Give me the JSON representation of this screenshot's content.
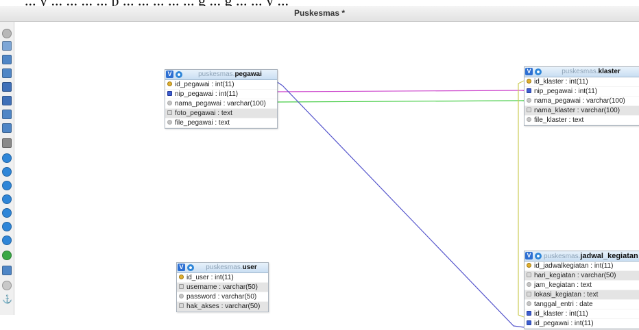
{
  "app": {
    "window_title": "Puskesmas *"
  },
  "top_text": "... y ... ... ... ... p ... ... ... ... ... g ... g ... ... y ...",
  "toolbar": [
    {
      "icon": "angular-links-icon",
      "color": "#b8b8b8",
      "shape": "round"
    },
    {
      "icon": "toggle-all-icon",
      "color": "#7da6d6",
      "shape": "sq"
    },
    {
      "icon": "add-tables-icon",
      "color": "#4f86c6",
      "shape": "sq"
    },
    {
      "icon": "edit-icon",
      "color": "#4f86c6",
      "shape": "sq"
    },
    {
      "icon": "save-icon",
      "color": "#3f70b8",
      "shape": "sq"
    },
    {
      "icon": "save-as-icon",
      "color": "#3f70b8",
      "shape": "sq"
    },
    {
      "icon": "delete-page-icon",
      "color": "#4f86c6",
      "shape": "sq"
    },
    {
      "icon": "view-icon",
      "color": "#4f86c6",
      "shape": "sq"
    },
    {
      "icon": "relation-icon",
      "color": "#8a8a8a",
      "shape": "sq"
    },
    {
      "icon": "toggle-small-big-icon",
      "color": "#2f86d8",
      "shape": "round"
    },
    {
      "icon": "toggle-keys-icon",
      "color": "#2f86d8",
      "shape": "round"
    },
    {
      "icon": "help-icon",
      "color": "#2f86d8",
      "shape": "round"
    },
    {
      "icon": "export-icon",
      "color": "#2f86d8",
      "shape": "round"
    },
    {
      "icon": "import-icon",
      "color": "#2f86d8",
      "shape": "round"
    },
    {
      "icon": "relation-lines-icon",
      "color": "#2f86d8",
      "shape": "round"
    },
    {
      "icon": "snap-grid-icon",
      "color": "#2f86d8",
      "shape": "round"
    },
    {
      "icon": "database-icon",
      "color": "#3aa845",
      "shape": "round"
    },
    {
      "icon": "pdf-icon",
      "color": "#4f86c6",
      "shape": "sq"
    },
    {
      "icon": "minimize-icon",
      "color": "#c8c8c8",
      "shape": "round"
    },
    {
      "icon": "anchor-icon",
      "color": "#777777",
      "shape": "anchor"
    }
  ],
  "tables": {
    "pegawai": {
      "db": "puskesmas",
      "sep": ".",
      "name": "pegawai",
      "columns": [
        {
          "label": "id_pegawai : int(11)",
          "key": "pk"
        },
        {
          "label": "nip_pegawai : int(11)",
          "key": "fk"
        },
        {
          "label": "nama_pegawai : varchar(100)",
          "key": "none"
        },
        {
          "label": "foto_pegawai : text",
          "key": "txt"
        },
        {
          "label": "file_pegawai : text",
          "key": "none"
        }
      ]
    },
    "klaster": {
      "db": "puskesmas",
      "sep": ".",
      "name": "klaster",
      "columns": [
        {
          "label": "id_klaster : int(11)",
          "key": "pk"
        },
        {
          "label": "nip_pegawai : int(11)",
          "key": "fk"
        },
        {
          "label": "nama_pegawai : varchar(100)",
          "key": "none"
        },
        {
          "label": "nama_klaster : varchar(100)",
          "key": "txt"
        },
        {
          "label": "file_klaster : text",
          "key": "none"
        }
      ]
    },
    "user": {
      "db": "puskesmas",
      "sep": ".",
      "name": "user",
      "columns": [
        {
          "label": "id_user : int(11)",
          "key": "pk"
        },
        {
          "label": "username : varchar(50)",
          "key": "txt"
        },
        {
          "label": "password : varchar(50)",
          "key": "none"
        },
        {
          "label": "hak_akses : varchar(50)",
          "key": "txt"
        }
      ]
    },
    "jadwal": {
      "db": "puskesmas",
      "sep": ".",
      "name": "jadwal_kegiatan",
      "columns": [
        {
          "label": "id_jadwalkegiatan : int(11)",
          "key": "pk"
        },
        {
          "label": "hari_kegiatan : varchar(50)",
          "key": "txt"
        },
        {
          "label": "jam_kegiatan : text",
          "key": "none"
        },
        {
          "label": "lokasi_kegiatan : text",
          "key": "txt"
        },
        {
          "label": "tanggal_entri : date",
          "key": "none"
        },
        {
          "label": "id_klaster : int(11)",
          "key": "fk"
        },
        {
          "label": "id_pegawai : int(11)",
          "key": "fk"
        }
      ]
    }
  },
  "relations": [
    {
      "name": "pegawai-nip-to-klaster-nip",
      "color": "#cc44cc"
    },
    {
      "name": "pegawai-nama-to-klaster-nama",
      "color": "#44cc44"
    },
    {
      "name": "pegawai-id-to-jadwal-id-pegawai",
      "color": "#5555cc"
    },
    {
      "name": "klaster-id-to-jadwal-id-klaster",
      "color": "#cccc55"
    }
  ]
}
